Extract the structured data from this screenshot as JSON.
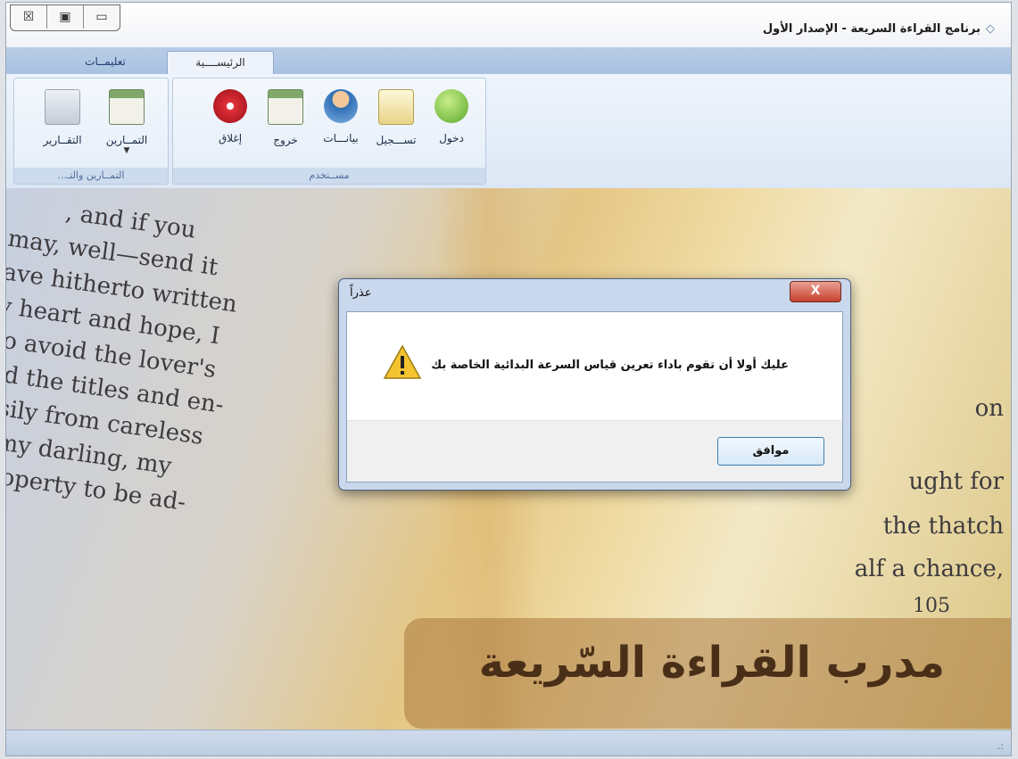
{
  "window": {
    "title": "برنامج القراءة السريعة - الإصدار الأول",
    "controls": [
      "☒",
      "▣",
      "▭"
    ]
  },
  "tabs": [
    {
      "label": "الرئيســــية",
      "active": true
    },
    {
      "label": "تعليمــات",
      "active": false
    }
  ],
  "ribbon": {
    "groups": [
      {
        "label": "مســتخدم",
        "buttons": [
          {
            "label": "دخول",
            "icon": "user-login-icon"
          },
          {
            "label": "تســـجيل",
            "icon": "register-pencil-icon"
          },
          {
            "label": "بيانـــات",
            "icon": "user-data-icon"
          },
          {
            "label": "خروج",
            "icon": "logout-icon"
          },
          {
            "label": "إغلاق",
            "icon": "close-stop-icon"
          }
        ]
      },
      {
        "label": "التمــارين والتـ...",
        "buttons": [
          {
            "label": "التمــارين",
            "icon": "exercises-icon"
          },
          {
            "label": "التقــارير",
            "icon": "reports-icon"
          }
        ]
      }
    ]
  },
  "background_text": {
    "left_lines": [
      ", and if you",
      "may, well—send it",
      "ave hitherto written",
      "y heart and hope, I",
      "to avoid the lover's",
      "nd the titles and en-",
      "asily from careless",
      "t my darling, my",
      "property to be ad-"
    ],
    "right_lines": [
      "on",
      "ught for",
      "the thatch",
      "alf a chance,",
      "105"
    ]
  },
  "brand": {
    "title": "مدرب القراءة السّريعة"
  },
  "dialog": {
    "title": "عذراً",
    "close_label": "X",
    "message": "عليك أولا أن تقوم باداء تعرين قياس السرعة البدائية الخاصة بك",
    "ok_label": "موافق"
  },
  "colors": {
    "accent": "#4d7cc2",
    "ribbon": "#dce7f5",
    "brand_panel": "#aa783c"
  }
}
